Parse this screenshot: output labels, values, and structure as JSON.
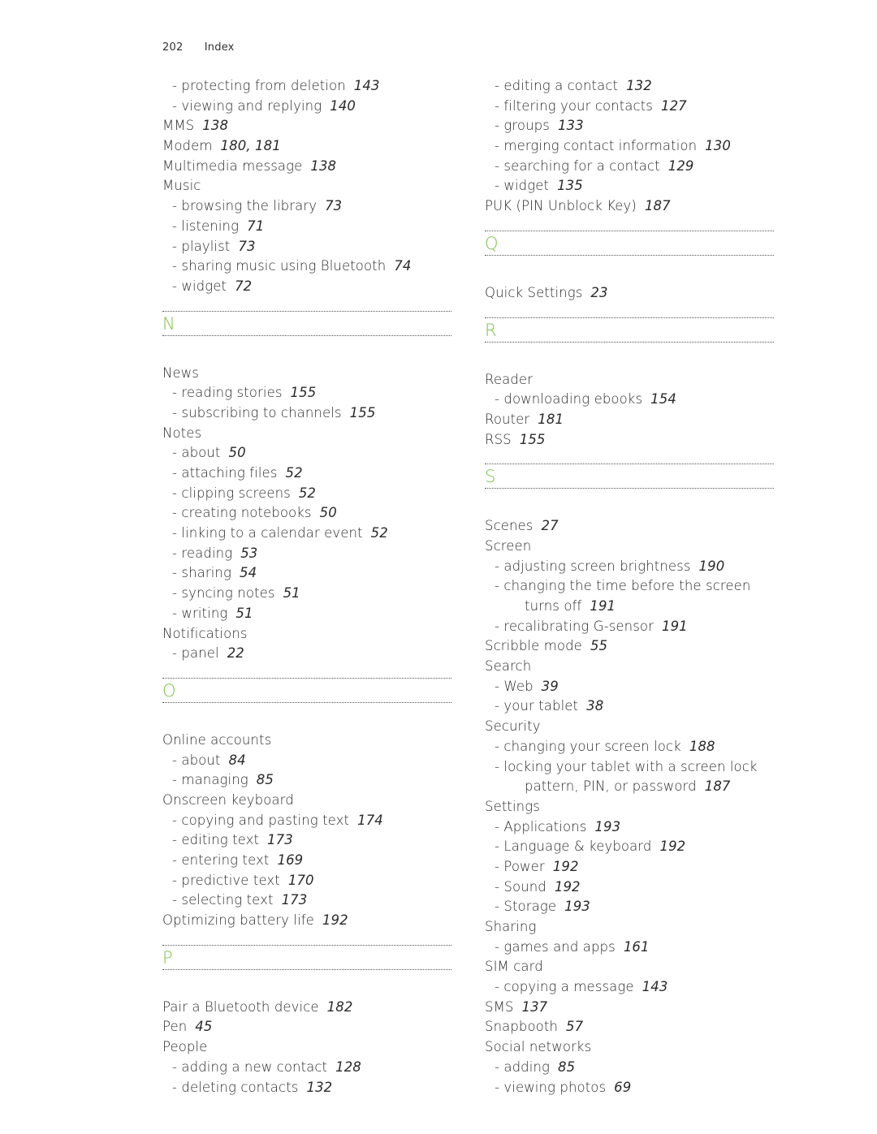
{
  "header": {
    "page_number": "202",
    "section": "Index"
  },
  "accent_color": "#7dc243",
  "columns": [
    {
      "blocks": [
        {
          "type": "entries",
          "items": [
            {
              "level": "sub",
              "text": "- protecting from deletion",
              "pages": "143"
            },
            {
              "level": "sub",
              "text": "- viewing and replying",
              "pages": "140"
            },
            {
              "level": "main",
              "text": "MMS",
              "pages": "138"
            },
            {
              "level": "main",
              "text": "Modem",
              "pages": "180, 181"
            },
            {
              "level": "main",
              "text": "Multimedia message",
              "pages": "138"
            },
            {
              "level": "main",
              "text": "Music",
              "pages": ""
            },
            {
              "level": "sub",
              "text": "- browsing the library",
              "pages": "73"
            },
            {
              "level": "sub",
              "text": "- listening",
              "pages": "71"
            },
            {
              "level": "sub",
              "text": "- playlist",
              "pages": "73"
            },
            {
              "level": "sub",
              "text": "- sharing music using Bluetooth",
              "pages": "74"
            },
            {
              "level": "sub",
              "text": "- widget",
              "pages": "72"
            }
          ]
        },
        {
          "type": "section",
          "letter": "N"
        },
        {
          "type": "entries",
          "items": [
            {
              "level": "main",
              "text": "News",
              "pages": ""
            },
            {
              "level": "sub",
              "text": "- reading stories",
              "pages": "155"
            },
            {
              "level": "sub",
              "text": "- subscribing to channels",
              "pages": "155"
            },
            {
              "level": "main",
              "text": "Notes",
              "pages": ""
            },
            {
              "level": "sub",
              "text": "- about",
              "pages": "50"
            },
            {
              "level": "sub",
              "text": "- attaching files",
              "pages": "52"
            },
            {
              "level": "sub",
              "text": "- clipping screens",
              "pages": "52"
            },
            {
              "level": "sub",
              "text": "- creating notebooks",
              "pages": "50"
            },
            {
              "level": "sub",
              "text": "- linking to a calendar event",
              "pages": "52"
            },
            {
              "level": "sub",
              "text": "- reading",
              "pages": "53"
            },
            {
              "level": "sub",
              "text": "- sharing",
              "pages": "54"
            },
            {
              "level": "sub",
              "text": "- syncing notes",
              "pages": "51"
            },
            {
              "level": "sub",
              "text": "- writing",
              "pages": "51"
            },
            {
              "level": "main",
              "text": "Notifications",
              "pages": ""
            },
            {
              "level": "sub",
              "text": "- panel",
              "pages": "22"
            }
          ]
        },
        {
          "type": "section",
          "letter": "O"
        },
        {
          "type": "entries",
          "items": [
            {
              "level": "main",
              "text": "Online accounts",
              "pages": ""
            },
            {
              "level": "sub",
              "text": "- about",
              "pages": "84"
            },
            {
              "level": "sub",
              "text": "- managing",
              "pages": "85"
            },
            {
              "level": "main",
              "text": "Onscreen keyboard",
              "pages": ""
            },
            {
              "level": "sub",
              "text": "- copying and pasting text",
              "pages": "174"
            },
            {
              "level": "sub",
              "text": "- editing text",
              "pages": "173"
            },
            {
              "level": "sub",
              "text": "- entering text",
              "pages": "169"
            },
            {
              "level": "sub",
              "text": "- predictive text",
              "pages": "170"
            },
            {
              "level": "sub",
              "text": "- selecting text",
              "pages": "173"
            },
            {
              "level": "main",
              "text": "Optimizing battery life",
              "pages": "192"
            }
          ]
        },
        {
          "type": "section",
          "letter": "P"
        },
        {
          "type": "entries",
          "items": [
            {
              "level": "main",
              "text": "Pair a Bluetooth device",
              "pages": "182"
            },
            {
              "level": "main",
              "text": "Pen",
              "pages": "45"
            },
            {
              "level": "main",
              "text": "People",
              "pages": ""
            },
            {
              "level": "sub",
              "text": "- adding a new contact",
              "pages": "128"
            },
            {
              "level": "sub",
              "text": "- deleting contacts",
              "pages": "132"
            }
          ]
        }
      ]
    },
    {
      "blocks": [
        {
          "type": "entries",
          "items": [
            {
              "level": "sub",
              "text": "- editing a contact",
              "pages": "132"
            },
            {
              "level": "sub",
              "text": "- filtering your contacts",
              "pages": "127"
            },
            {
              "level": "sub",
              "text": "- groups",
              "pages": "133"
            },
            {
              "level": "sub",
              "text": "- merging contact information",
              "pages": "130"
            },
            {
              "level": "sub",
              "text": "- searching for a contact",
              "pages": "129"
            },
            {
              "level": "sub",
              "text": "- widget",
              "pages": "135"
            },
            {
              "level": "main",
              "text": "PUK (PIN Unblock Key)",
              "pages": "187"
            }
          ]
        },
        {
          "type": "section",
          "letter": "Q"
        },
        {
          "type": "entries",
          "items": [
            {
              "level": "main",
              "text": "Quick Settings",
              "pages": "23"
            }
          ]
        },
        {
          "type": "section",
          "letter": "R"
        },
        {
          "type": "entries",
          "items": [
            {
              "level": "main",
              "text": "Reader",
              "pages": ""
            },
            {
              "level": "sub",
              "text": "- downloading ebooks",
              "pages": "154"
            },
            {
              "level": "main",
              "text": "Router",
              "pages": "181"
            },
            {
              "level": "main",
              "text": "RSS",
              "pages": "155"
            }
          ]
        },
        {
          "type": "section",
          "letter": "S"
        },
        {
          "type": "entries",
          "items": [
            {
              "level": "main",
              "text": "Scenes",
              "pages": "27"
            },
            {
              "level": "main",
              "text": "Screen",
              "pages": ""
            },
            {
              "level": "sub",
              "text": "- adjusting screen brightness",
              "pages": "190"
            },
            {
              "level": "sub",
              "text": "- changing the time before the screen",
              "pages": ""
            },
            {
              "level": "cont",
              "text": "turns off",
              "pages": "191"
            },
            {
              "level": "sub",
              "text": "- recalibrating G-sensor",
              "pages": "191"
            },
            {
              "level": "main",
              "text": "Scribble mode",
              "pages": "55"
            },
            {
              "level": "main",
              "text": "Search",
              "pages": ""
            },
            {
              "level": "sub",
              "text": "- Web",
              "pages": "39"
            },
            {
              "level": "sub",
              "text": "- your tablet",
              "pages": "38"
            },
            {
              "level": "main",
              "text": "Security",
              "pages": ""
            },
            {
              "level": "sub",
              "text": "- changing your screen lock",
              "pages": "188"
            },
            {
              "level": "sub",
              "text": "- locking your tablet with a screen lock",
              "pages": ""
            },
            {
              "level": "cont",
              "text": "pattern, PIN, or password",
              "pages": "187"
            },
            {
              "level": "main",
              "text": "Settings",
              "pages": ""
            },
            {
              "level": "sub",
              "text": "- Applications",
              "pages": "193"
            },
            {
              "level": "sub",
              "text": "- Language & keyboard",
              "pages": "192"
            },
            {
              "level": "sub",
              "text": "- Power",
              "pages": "192"
            },
            {
              "level": "sub",
              "text": "- Sound",
              "pages": "192"
            },
            {
              "level": "sub",
              "text": "- Storage",
              "pages": "193"
            },
            {
              "level": "main",
              "text": "Sharing",
              "pages": ""
            },
            {
              "level": "sub",
              "text": "- games and apps",
              "pages": "161"
            },
            {
              "level": "main",
              "text": "SIM card",
              "pages": ""
            },
            {
              "level": "sub",
              "text": "- copying a message",
              "pages": "143"
            },
            {
              "level": "main",
              "text": "SMS",
              "pages": "137"
            },
            {
              "level": "main",
              "text": "Snapbooth",
              "pages": "57"
            },
            {
              "level": "main",
              "text": "Social networks",
              "pages": ""
            },
            {
              "level": "sub",
              "text": "- adding",
              "pages": "85"
            },
            {
              "level": "sub",
              "text": "- viewing photos",
              "pages": "69"
            }
          ]
        }
      ]
    }
  ]
}
